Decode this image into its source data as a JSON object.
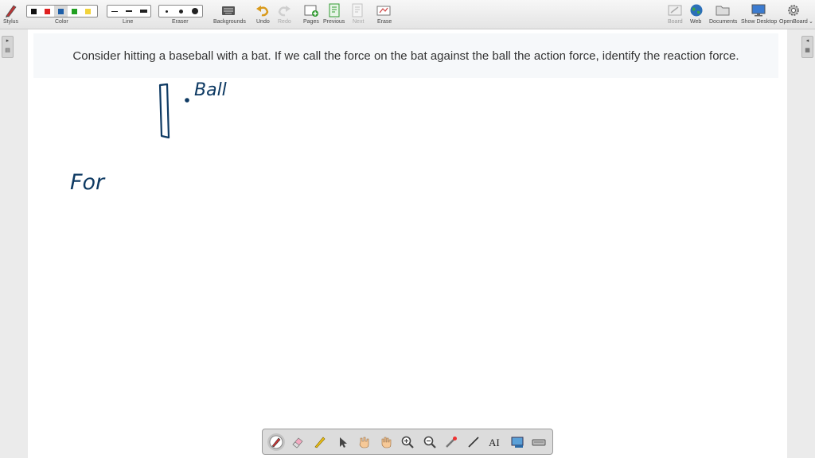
{
  "toolbar": {
    "stylus_label": "Stylus",
    "color_label": "Color",
    "line_label": "Line",
    "eraser_label": "Eraser",
    "backgrounds_label": "Backgrounds",
    "undo_label": "Undo",
    "redo_label": "Redo",
    "pages_label": "Pages",
    "previous_label": "Previous",
    "next_label": "Next",
    "erase_label": "Erase",
    "board_label": "Board",
    "web_label": "Web",
    "documents_label": "Documents",
    "show_desktop_label": "Show Desktop",
    "openboard_label": "OpenBoard",
    "colors": [
      "#111111",
      "#e02020",
      "#1d5ea8",
      "#22a022",
      "#f2d33a"
    ],
    "selected_color": "#1d5ea8"
  },
  "board": {
    "question": "Consider hitting a baseball with a bat. If we call the force on the bat against the ball the action force, identify the reaction force.",
    "handwriting_ball": "Ball",
    "handwriting_for": "For",
    "ink_color": "#0e3a63"
  },
  "bottom_tools": [
    "pen-icon",
    "eraser-icon",
    "highlighter-icon",
    "pointer-icon",
    "laser-hand-icon",
    "hand-icon",
    "zoom-in-icon",
    "zoom-out-icon",
    "laser-pointer-icon",
    "line-icon",
    "text-icon",
    "capture-icon",
    "virtual-keyboard-icon"
  ]
}
